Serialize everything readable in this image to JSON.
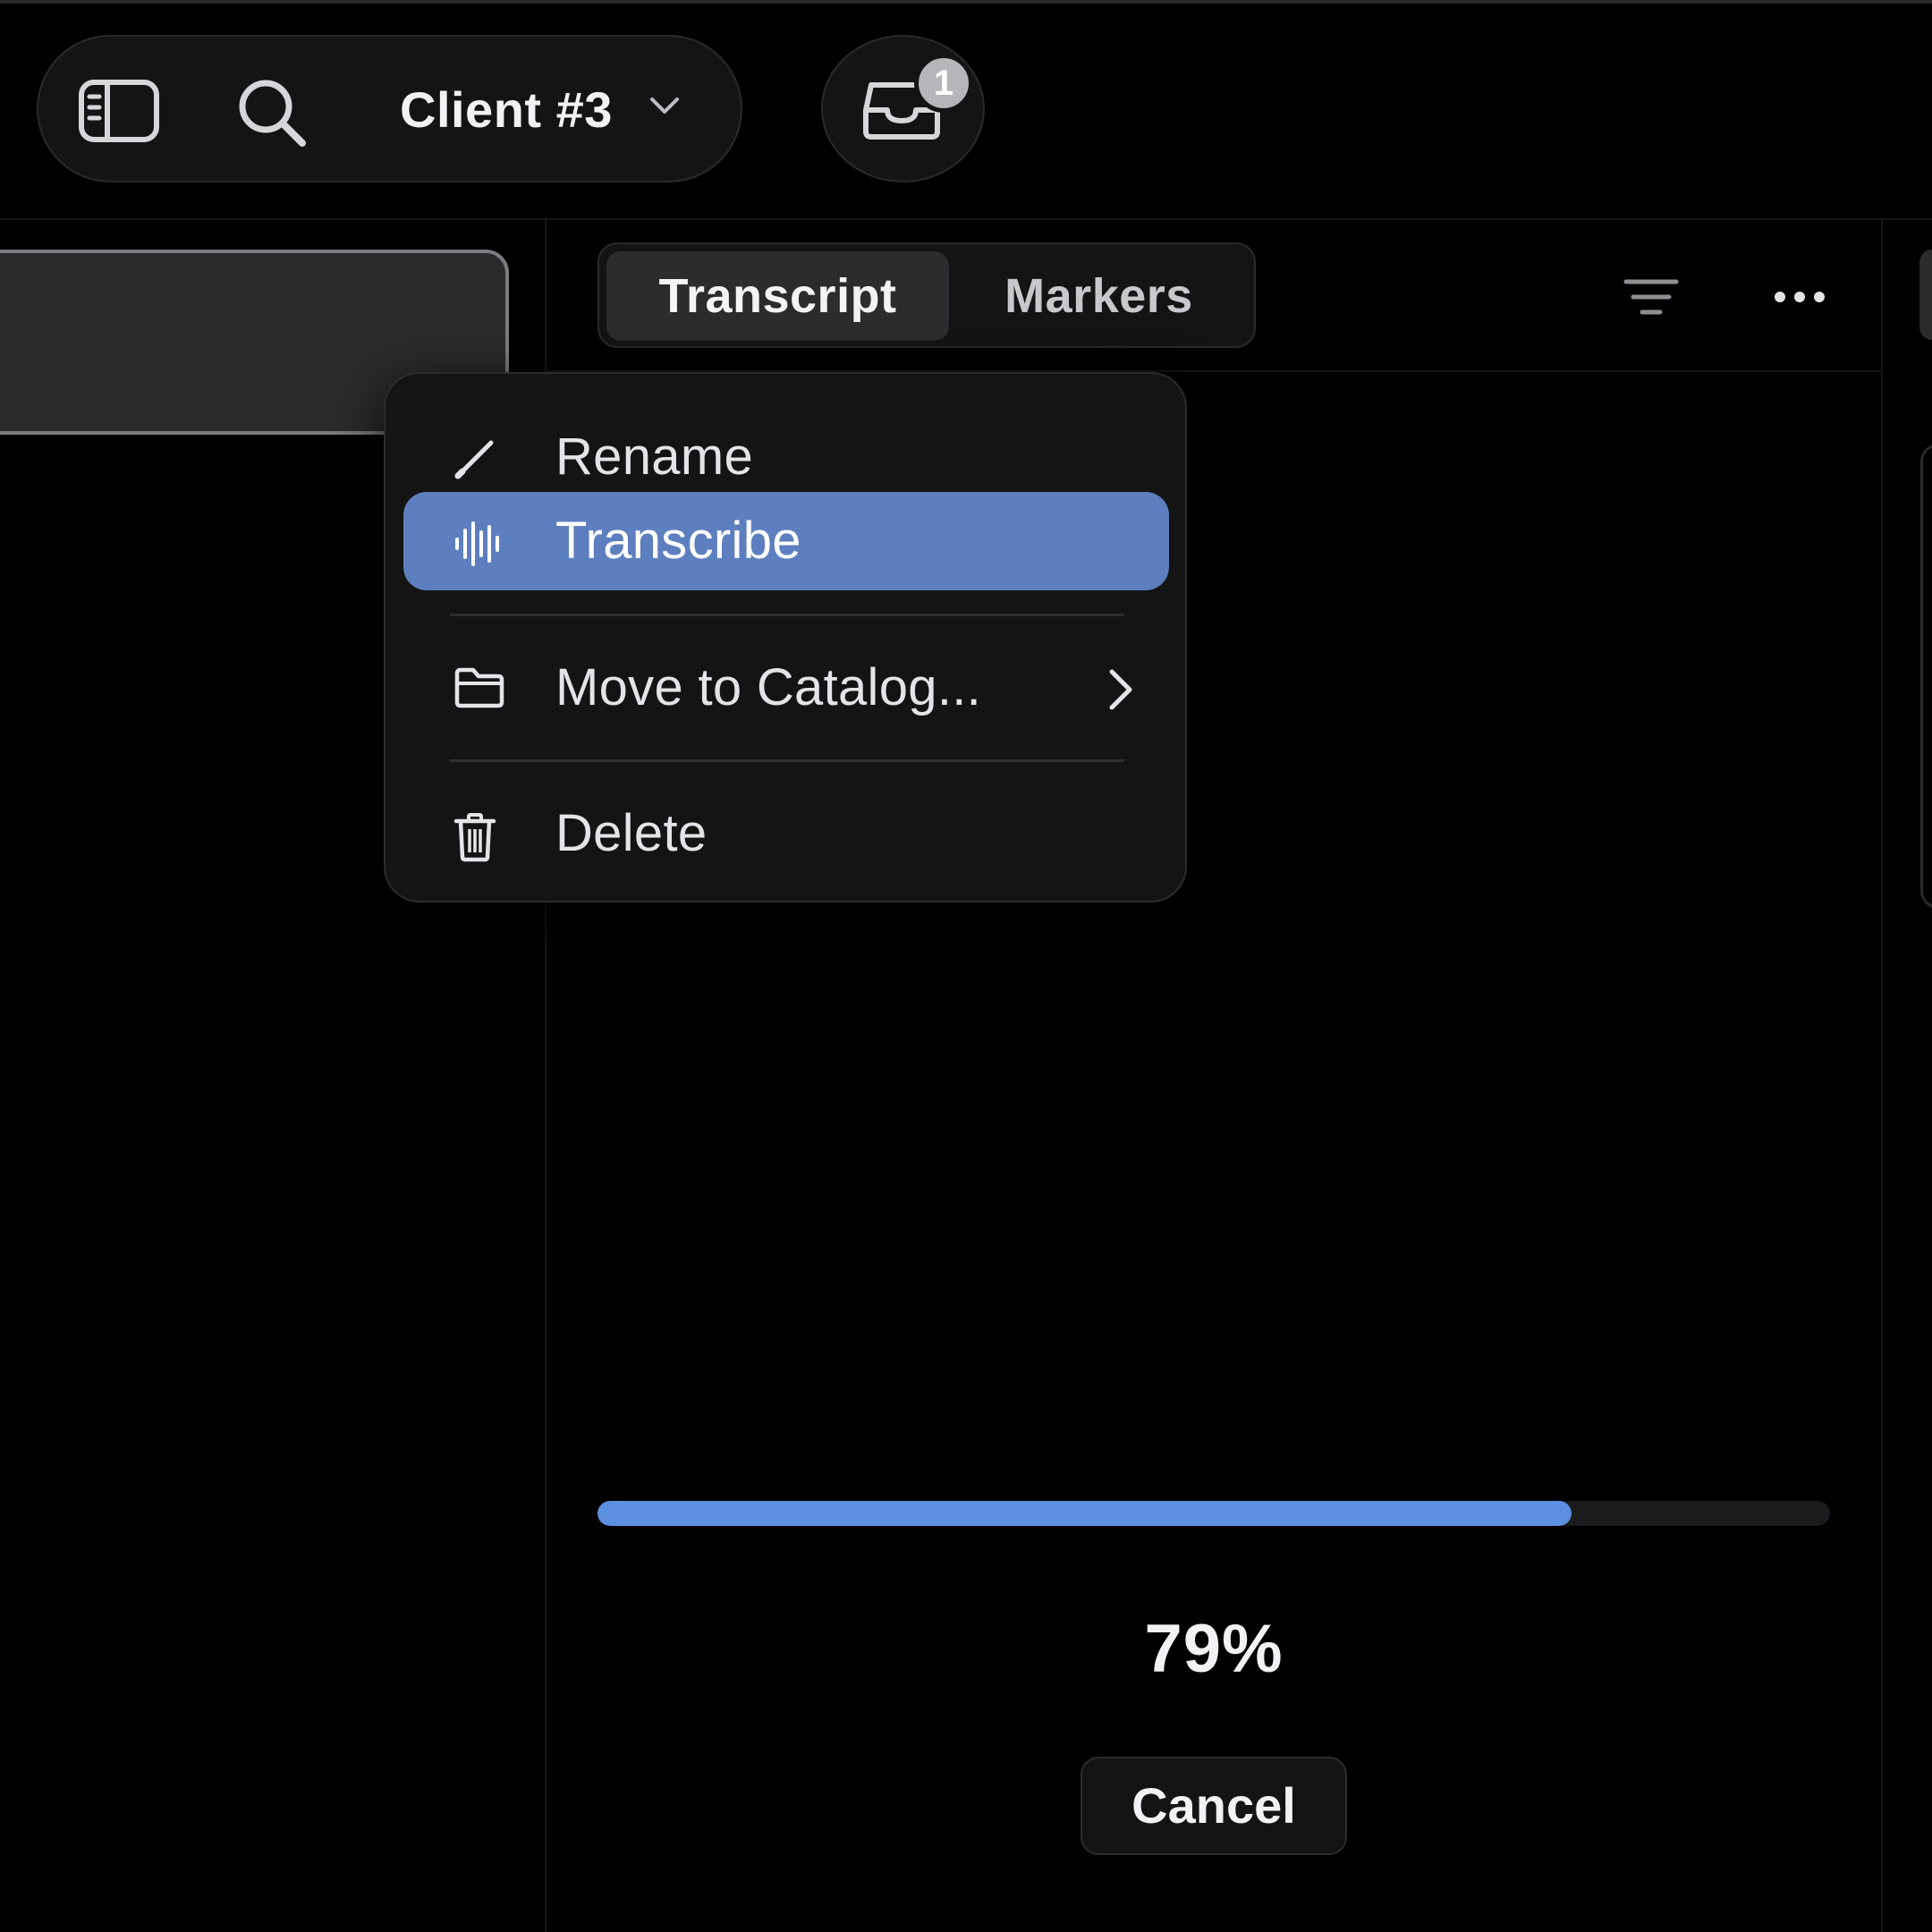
{
  "toolbar": {
    "sidebar_icon": "sidebar-toggle-icon",
    "search_icon": "search-icon",
    "workspace_title": "Client #3",
    "workspace_chevron": "chevron-down-icon"
  },
  "inbox": {
    "icon": "inbox-tray-icon",
    "badge_count": "1"
  },
  "tabs": [
    {
      "label": "Transcript",
      "active": true
    },
    {
      "label": "Markers",
      "active": false
    }
  ],
  "actions": {
    "filter_icon": "filter-lines-icon",
    "more_icon": "more-horizontal-icon"
  },
  "context_menu": {
    "items": [
      {
        "label": "Rename",
        "icon": "pencil-icon"
      },
      {
        "label": "Transcribe",
        "icon": "waveform-icon",
        "highlighted": true
      },
      {
        "label": "Move to Catalog...",
        "icon": "folder-icon",
        "submenu": true
      },
      {
        "label": "Delete",
        "icon": "trash-icon"
      }
    ]
  },
  "progress": {
    "value": 0.79,
    "label": "79%",
    "cancel_label": "Cancel"
  },
  "colors": {
    "accent": "#5d7fbf",
    "progress": "#5c8fe0",
    "background": "#000000"
  }
}
